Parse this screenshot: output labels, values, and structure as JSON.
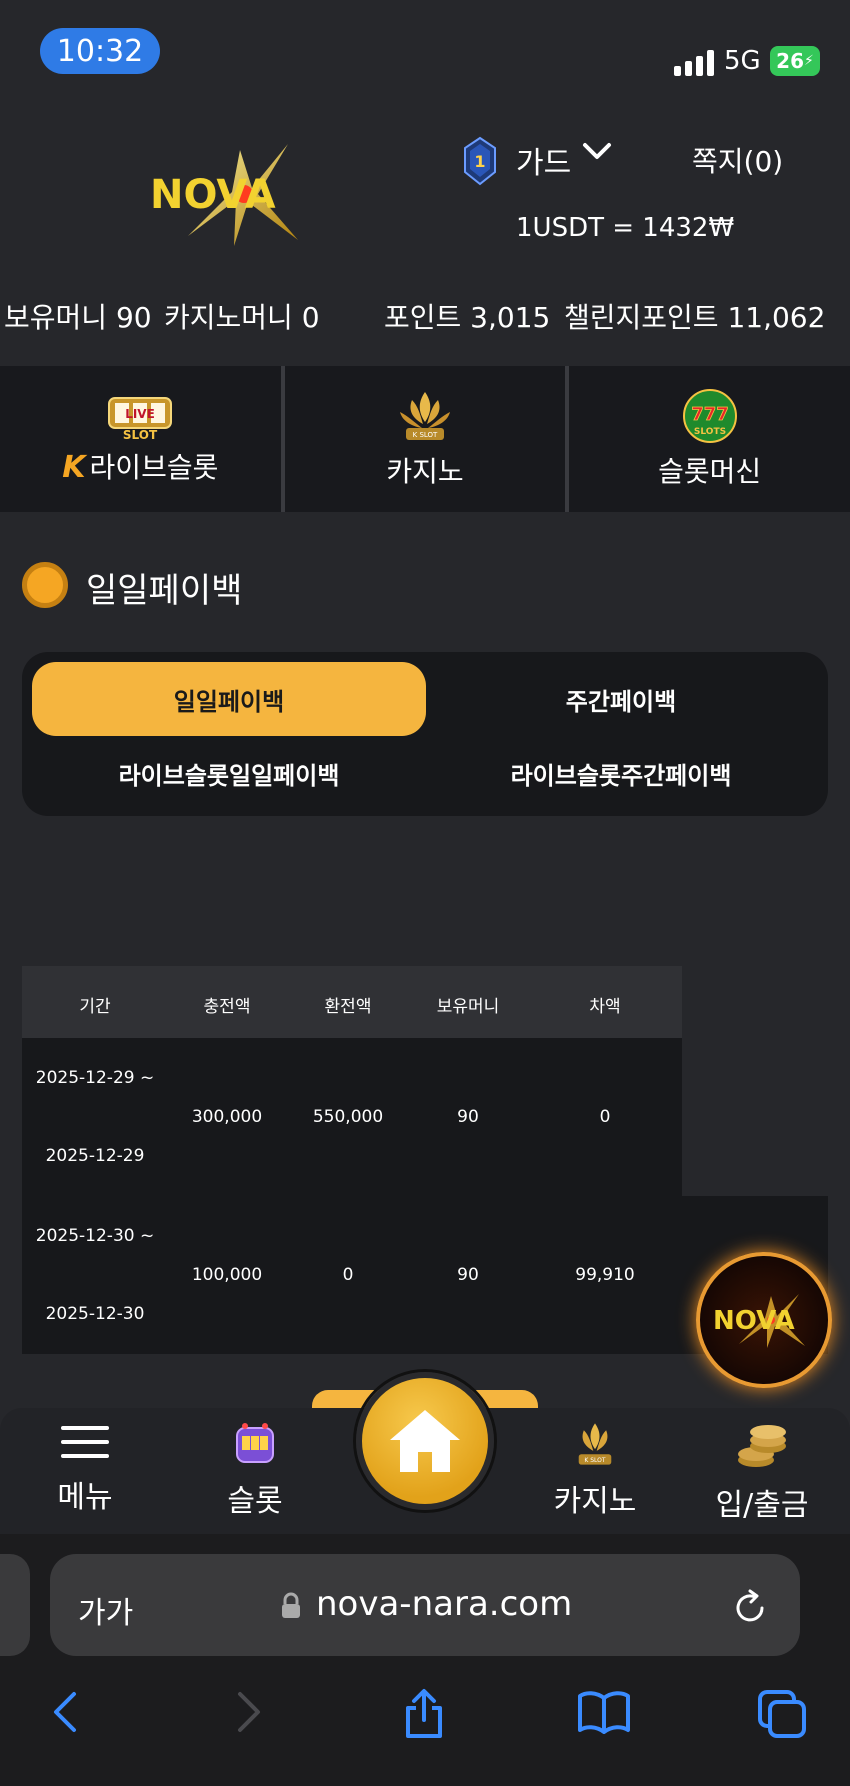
{
  "status_bar": {
    "time": "10:32",
    "network": "5G",
    "battery": "26"
  },
  "header": {
    "logo_text": "NOVA",
    "rank_badge": "1",
    "user_name": "가드",
    "messages": "쪽지(0)",
    "exchange_rate": "1USDT = 1432₩"
  },
  "balances": {
    "holding_money": "보유머니 90",
    "casino_money": "카지노머니 0",
    "points": "포인트 3,015",
    "challenge_points": "챌린지포인트 11,062"
  },
  "game_tabs": [
    {
      "label": "라이브슬롯",
      "icon": "live-slot-icon"
    },
    {
      "label": "카지노",
      "icon": "k-slot-casino-icon"
    },
    {
      "label": "슬롯머신",
      "icon": "777-slots-icon"
    }
  ],
  "section": {
    "title": "일일페이백"
  },
  "payback_tabs": [
    {
      "label": "일일페이백",
      "active": true
    },
    {
      "label": "주간페이백",
      "active": false
    },
    {
      "label": "라이브슬롯일일페이백",
      "active": false
    },
    {
      "label": "라이브슬롯주간페이백",
      "active": false
    }
  ],
  "table": {
    "headers": [
      "기간",
      "충전액",
      "환전액",
      "보유머니",
      "차액"
    ],
    "rows": [
      {
        "period_start": "2025-12-29 ~",
        "period_end": "2025-12-29",
        "deposit": "300,000",
        "withdrawal": "550,000",
        "holding": "90",
        "difference": "0"
      },
      {
        "period_start": "2025-12-30 ~",
        "period_end": "2025-12-30",
        "deposit": "100,000",
        "withdrawal": "0",
        "holding": "90",
        "difference": "99,910"
      }
    ]
  },
  "bottom_nav": {
    "menu": "메뉴",
    "slot": "슬롯",
    "casino": "카지노",
    "deposit_withdraw": "입/출금"
  },
  "safari": {
    "text_size": "가가",
    "url": "nova-nara.com"
  },
  "colors": {
    "accent": "#f5b53f",
    "background": "#26272b",
    "panel": "#17181b"
  }
}
